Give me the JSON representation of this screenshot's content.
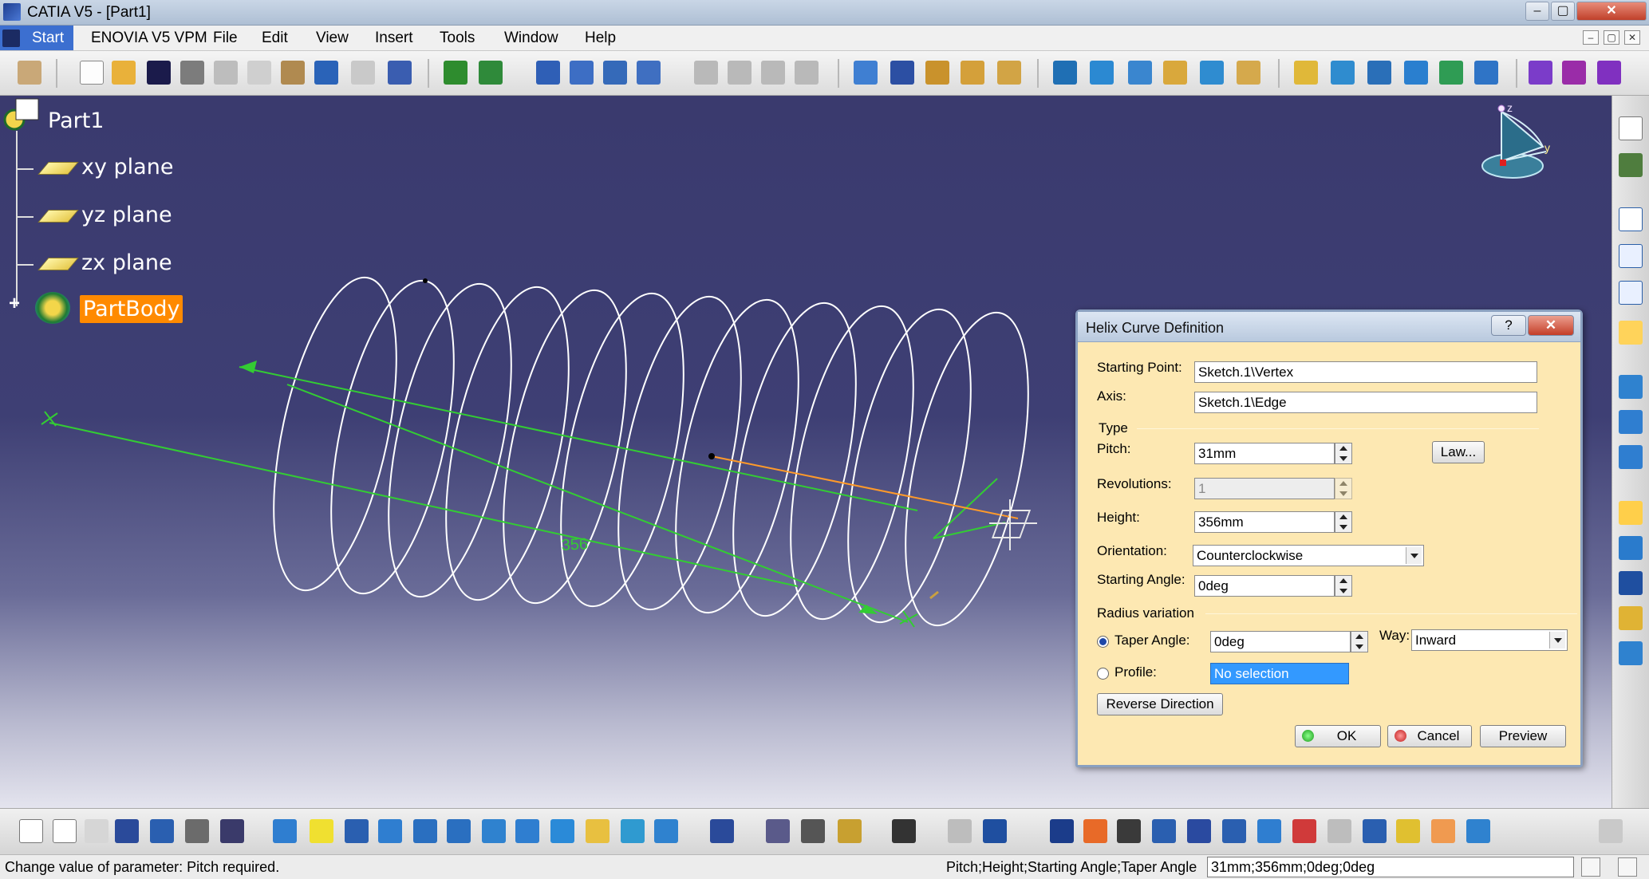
{
  "window": {
    "title": "CATIA V5 - [Part1]"
  },
  "menu": {
    "start": "Start",
    "items": [
      "ENOVIA V5 VPM",
      "File",
      "Edit",
      "View",
      "Insert",
      "Tools",
      "Window",
      "Help"
    ]
  },
  "tree": {
    "root": "Part1",
    "children": [
      "xy plane",
      "yz plane",
      "zx plane",
      "PartBody"
    ]
  },
  "compass": {
    "axis_z": "z",
    "axis_y": "y"
  },
  "viewport": {
    "dimension_label": "356"
  },
  "dialog": {
    "title": "Helix Curve Definition",
    "help_label": "?",
    "close_label": "✕",
    "starting_point_label": "Starting Point:",
    "starting_point_value": "Sketch.1\\Vertex",
    "axis_label": "Axis:",
    "axis_value": "Sketch.1\\Edge",
    "type_group": "Type",
    "pitch_label": "Pitch:",
    "pitch_value": "31mm",
    "law_label": "Law...",
    "revolutions_label": "Revolutions:",
    "revolutions_value": "1",
    "height_label": "Height:",
    "height_value": "356mm",
    "orientation_label": "Orientation:",
    "orientation_value": "Counterclockwise",
    "starting_angle_label": "Starting Angle:",
    "starting_angle_value": "0deg",
    "radius_group": "Radius variation",
    "taper_label": "Taper Angle:",
    "taper_value": "0deg",
    "way_label": "Way:",
    "way_value": "Inward",
    "profile_label": "Profile:",
    "profile_value": "No selection",
    "reverse_label": "Reverse Direction",
    "ok_label": "OK",
    "cancel_label": "Cancel",
    "preview_label": "Preview"
  },
  "status": {
    "message": "Change value of parameter: Pitch required.",
    "param_names": "Pitch;Height;Starting Angle;Taper Angle",
    "param_values": "31mm;356mm;0deg;0deg"
  },
  "colors": {
    "viewport_bg": "#3a3a6e",
    "curve": "#ffffff",
    "axis_green": "#33cc33",
    "dialog_bg": "#fde8b2",
    "selection_orange": "#ff8a00"
  }
}
